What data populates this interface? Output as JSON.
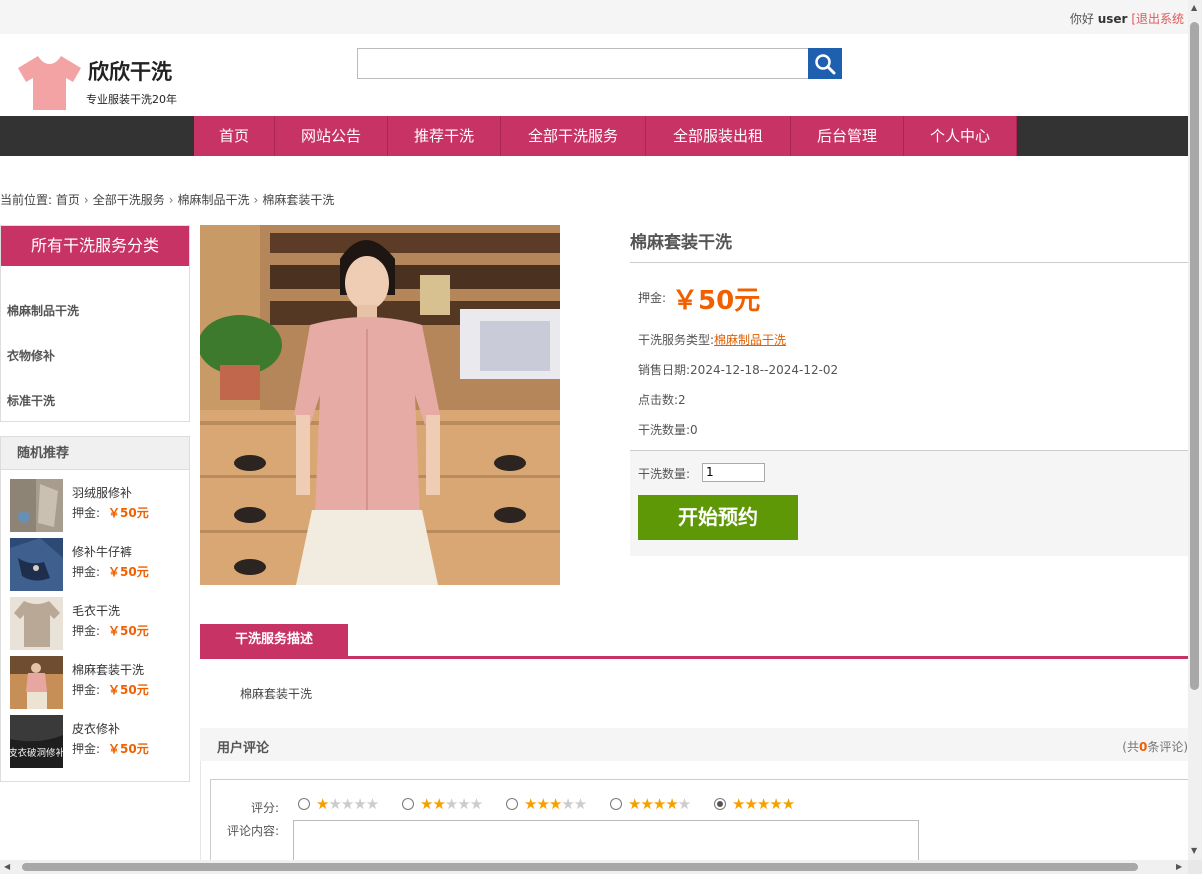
{
  "topbar": {
    "greeting": "你好",
    "username": "user",
    "logout": "[退出系统"
  },
  "logo": {
    "title": "欣欣干洗",
    "subtitle": "专业服装干洗20年",
    "icon": "tshirt-icon",
    "color": "#f4a3a5"
  },
  "search": {
    "placeholder": "",
    "value": "",
    "button_icon": "search-icon"
  },
  "nav": {
    "items": [
      "首页",
      "网站公告",
      "推荐干洗",
      "全部干洗服务",
      "全部服装出租",
      "后台管理",
      "个人中心"
    ]
  },
  "breadcrumb": {
    "prefix": "当前位置:",
    "items": [
      "首页",
      "全部干洗服务",
      "棉麻制品干洗",
      "棉麻套装干洗"
    ]
  },
  "sidebar": {
    "category_title": "所有干洗服务分类",
    "categories": [
      "棉麻制品干洗",
      "衣物修补",
      "标准干洗"
    ],
    "recommend_title": "随机推荐",
    "recommend_price_label": "押金:",
    "recommend": [
      {
        "name": "羽绒服修补",
        "price": "￥50元"
      },
      {
        "name": "修补牛仔裤",
        "price": "￥50元"
      },
      {
        "name": "毛衣干洗",
        "price": "￥50元"
      },
      {
        "name": "棉麻套装干洗",
        "price": "￥50元"
      },
      {
        "name": "皮衣修补",
        "price": "￥50元",
        "thumb_text": "皮衣破洞修补"
      }
    ]
  },
  "product": {
    "title": "棉麻套装干洗",
    "deposit_label": "押金:",
    "price": "￥50元",
    "type_label": "干洗服务类型:",
    "type_value": "棉麻制品干洗",
    "date_label": "销售日期:",
    "date_value": "2024-12-18--2024-12-02",
    "clicks_label": "点击数:",
    "clicks_value": "2",
    "count_label": "干洗数量:",
    "count_value": "0",
    "qty_label": "干洗数量:",
    "qty_value": "1",
    "book_button": "开始预约"
  },
  "description": {
    "tab": "干洗服务描述",
    "text": "棉麻套装干洗"
  },
  "reviews": {
    "title": "用户评论",
    "count_prefix": "(共",
    "count": "0",
    "count_suffix": "条评论)",
    "rating_label": "评分:",
    "content_label": "评论内容:",
    "selected_rating": 5,
    "max_rating": 5
  },
  "colors": {
    "accent": "#c83366",
    "price": "#f06000",
    "book_button": "#5f9806",
    "search_button": "#1f5fb0",
    "nav_bg": "#333333"
  }
}
